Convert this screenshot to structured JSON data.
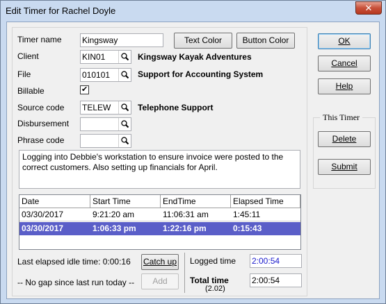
{
  "window": {
    "title": "Edit Timer for Rachel Doyle",
    "close_glyph": "✕"
  },
  "form": {
    "timer_name_label": "Timer name",
    "timer_name_value": "Kingsway",
    "text_color_btn": "Text Color",
    "button_color_btn": "Button Color",
    "client_label": "Client",
    "client_value": "KIN01",
    "client_desc": "Kingsway Kayak Adventures",
    "file_label": "File",
    "file_value": "010101",
    "file_desc": "Support for Accounting System",
    "billable_label": "Billable",
    "billable_checked": true,
    "billable_check_glyph": "✔",
    "source_code_label": "Source code",
    "source_code_value": "TELEW",
    "source_code_desc": "Telephone Support",
    "disbursement_label": "Disbursement",
    "disbursement_value": "",
    "phrase_code_label": "Phrase code",
    "phrase_code_value": ""
  },
  "notes": "Logging into Debbie's workstation to ensure invoice were posted to the correct customers. Also setting up financials for April.",
  "grid": {
    "columns": [
      "Date",
      "Start Time",
      "EndTime",
      "Elapsed Time"
    ],
    "rows": [
      {
        "date": "03/30/2017",
        "start": "9:21:20 am",
        "end": "11:06:31 am",
        "elapsed": "1:45:11",
        "selected": false
      },
      {
        "date": "03/30/2017",
        "start": "1:06:33 pm",
        "end": "1:22:16 pm",
        "elapsed": "0:15:43",
        "selected": true
      }
    ]
  },
  "bottom": {
    "idle_text": "Last elapsed idle time: 0:00:16",
    "gap_text": "-- No gap since last run today --",
    "catch_up_btn": "Catch up",
    "add_btn": "Add",
    "logged_time_label": "Logged time",
    "logged_time_value": "2:00:54",
    "total_time_label": "Total time",
    "total_time_value": "2:00:54",
    "total_time_hours": "(2.02)"
  },
  "side": {
    "ok_btn": "OK",
    "cancel_btn": "Cancel",
    "help_btn": "Help",
    "this_timer_label": "This Timer",
    "delete_btn": "Delete",
    "submit_btn": "Submit"
  },
  "colors": {
    "selected_row": "#5a5ec8",
    "logged_time_text": "#1a1acc"
  }
}
